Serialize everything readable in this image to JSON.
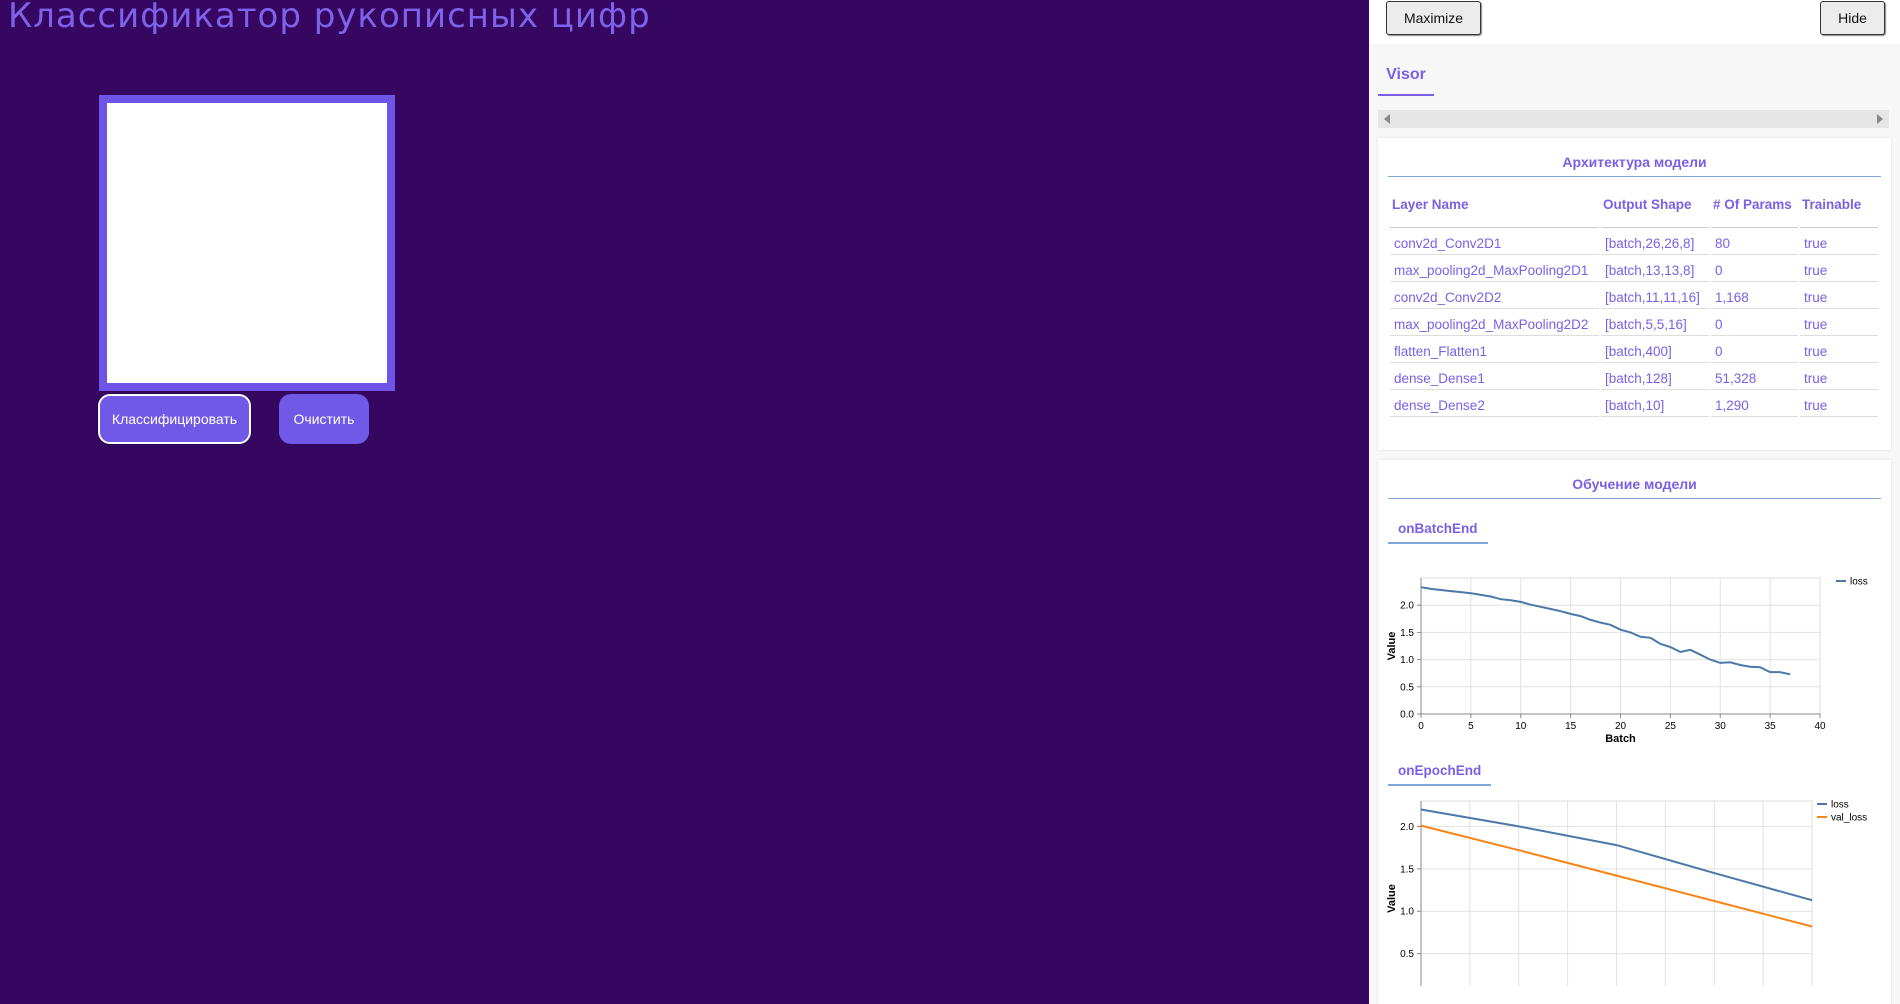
{
  "app": {
    "title": "Классификатор рукописных цифр",
    "classify_label": "Классифицировать",
    "clear_label": "Очистить"
  },
  "visor": {
    "maximize_label": "Maximize",
    "hide_label": "Hide",
    "tab_label": "Visor",
    "architecture": {
      "title": "Архитектура модели",
      "columns": [
        "Layer Name",
        "Output Shape",
        "# Of Params",
        "Trainable"
      ],
      "rows": [
        [
          "conv2d_Conv2D1",
          "[batch,26,26,8]",
          "80",
          "true"
        ],
        [
          "max_pooling2d_MaxPooling2D1",
          "[batch,13,13,8]",
          "0",
          "true"
        ],
        [
          "conv2d_Conv2D2",
          "[batch,11,11,16]",
          "1,168",
          "true"
        ],
        [
          "max_pooling2d_MaxPooling2D2",
          "[batch,5,5,16]",
          "0",
          "true"
        ],
        [
          "flatten_Flatten1",
          "[batch,400]",
          "0",
          "true"
        ],
        [
          "dense_Dense1",
          "[batch,128]",
          "51,328",
          "true"
        ],
        [
          "dense_Dense2",
          "[batch,10]",
          "1,290",
          "true"
        ]
      ]
    },
    "training": {
      "title": "Обучение модели",
      "batch_tab": "onBatchEnd",
      "epoch_tab": "onEpochEnd"
    }
  },
  "colors": {
    "background": "#360761",
    "accent": "#7159e8",
    "loss": "#4c78a8",
    "val_loss": "#f58518"
  },
  "chart_data": [
    {
      "type": "line",
      "xlabel": "Batch",
      "ylabel": "Value",
      "xlim": [
        0,
        40
      ],
      "ylim": [
        0,
        2.5
      ],
      "xticks": [
        0,
        5,
        10,
        15,
        20,
        25,
        30,
        35,
        40
      ],
      "yticks": [
        0.0,
        0.5,
        1.0,
        1.5,
        2.0
      ],
      "grid": true,
      "legend": "top-right",
      "series": [
        {
          "name": "loss",
          "color": "#4c78a8",
          "x": [
            0,
            1,
            2,
            3,
            4,
            5,
            6,
            7,
            8,
            9,
            10,
            11,
            12,
            13,
            14,
            15,
            16,
            17,
            18,
            19,
            20,
            21,
            22,
            23,
            24,
            25,
            26,
            27,
            28,
            29,
            30,
            31,
            32,
            33,
            34,
            35,
            36,
            37
          ],
          "y": [
            2.33,
            2.3,
            2.28,
            2.26,
            2.24,
            2.22,
            2.19,
            2.16,
            2.11,
            2.09,
            2.06,
            2.01,
            1.97,
            1.93,
            1.89,
            1.84,
            1.8,
            1.73,
            1.68,
            1.64,
            1.55,
            1.5,
            1.42,
            1.4,
            1.29,
            1.23,
            1.14,
            1.18,
            1.09,
            1.0,
            0.94,
            0.95,
            0.9,
            0.87,
            0.86,
            0.77,
            0.77,
            0.73
          ]
        }
      ]
    },
    {
      "type": "line",
      "ylabel": "Value",
      "ylim": [
        0,
        2.3
      ],
      "yticks": [
        0.5,
        1.0,
        1.5,
        2.0
      ],
      "grid": true,
      "legend": "top-right",
      "series": [
        {
          "name": "loss",
          "color": "#4c78a8",
          "x": [
            0,
            1,
            2,
            3,
            4
          ],
          "y": [
            2.2,
            2.0,
            1.78,
            1.45,
            1.13
          ]
        },
        {
          "name": "val_loss",
          "color": "#f58518",
          "x": [
            0,
            1,
            2,
            3,
            4
          ],
          "y": [
            2.01,
            1.72,
            1.42,
            1.12,
            0.82
          ]
        }
      ]
    }
  ]
}
